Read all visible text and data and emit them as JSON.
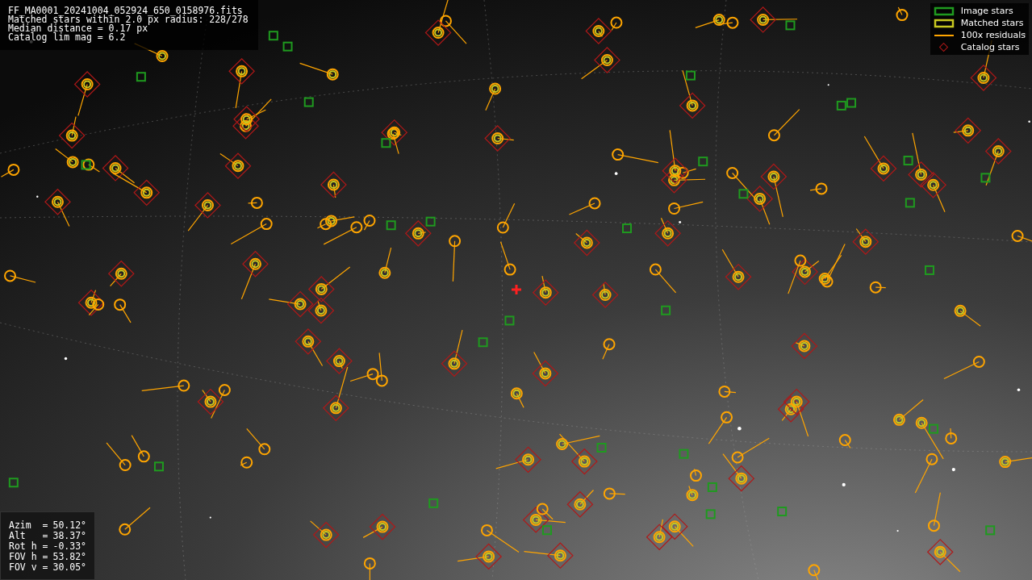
{
  "file_info": [
    "FF_MA0001_20241004_052924_650_0158976.fits",
    "Matched stars within 2.0 px radius: 228/278",
    "Median distance = 0.17 px",
    "Catalog lim mag = 6.2"
  ],
  "legend": [
    {
      "kind": "box",
      "label": "Image stars",
      "color": "#1f9a1f"
    },
    {
      "kind": "box",
      "label": "Matched stars",
      "color": "#c8c820"
    },
    {
      "kind": "line",
      "label": "100x residuals",
      "color": "#ffa500"
    },
    {
      "kind": "diamond",
      "label": "Catalog stars",
      "color": "#b01818"
    }
  ],
  "pointing": [
    {
      "label": "Azim  =",
      "value": "50.12°"
    },
    {
      "label": "Alt   =",
      "value": "38.37°"
    },
    {
      "label": "Rot h =",
      "value": "-0.33°"
    },
    {
      "label": "FOV h =",
      "value": "53.82°"
    },
    {
      "label": "FOV v =",
      "value": "30.05°"
    }
  ]
}
